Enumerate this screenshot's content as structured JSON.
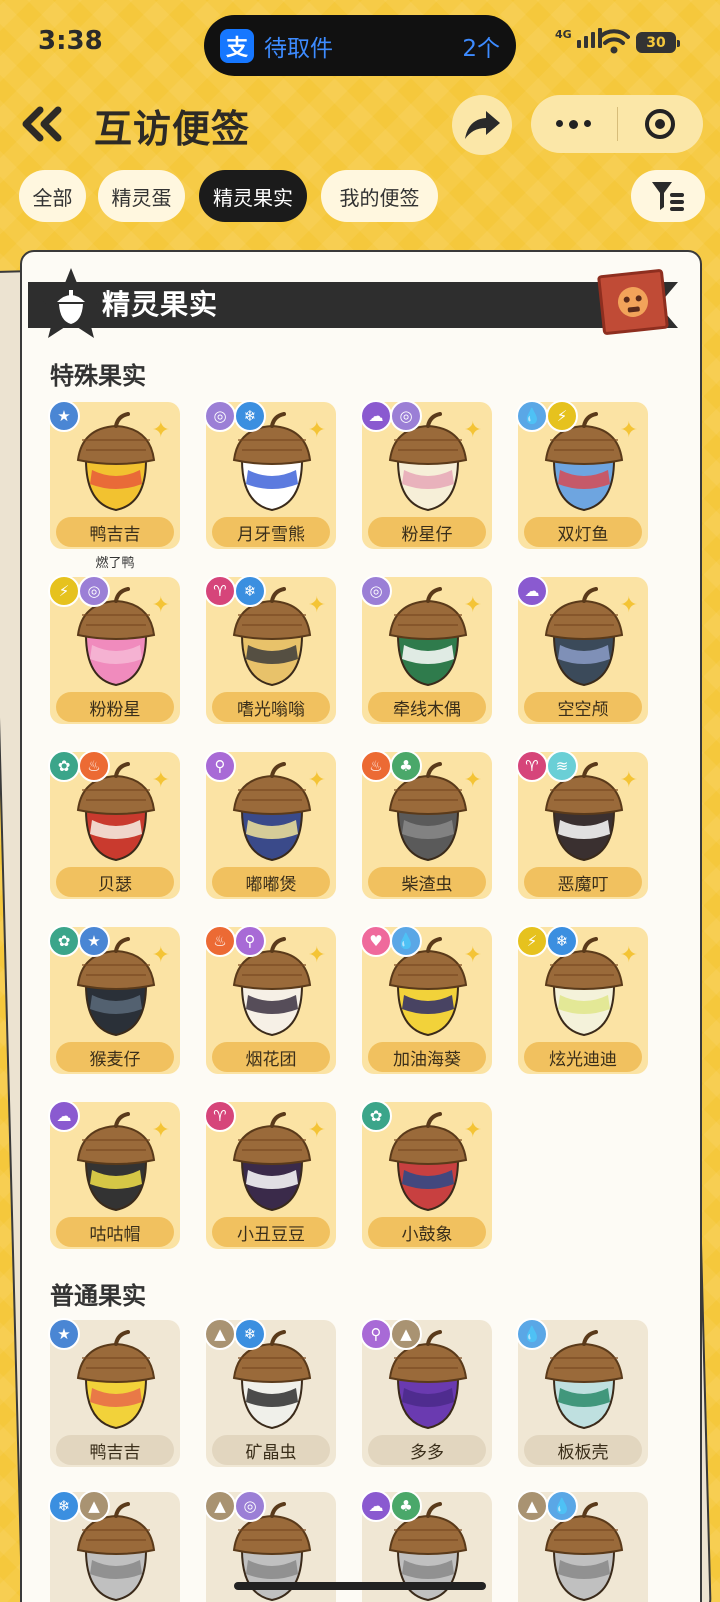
{
  "status_bar": {
    "time": "3:38",
    "island_text": "待取件",
    "island_count": "2个",
    "network": "4G",
    "battery": "30"
  },
  "nav": {
    "title": "互访便签"
  },
  "tabs": [
    {
      "label": "全部",
      "active": false
    },
    {
      "label": "精灵蛋",
      "active": false
    },
    {
      "label": "精灵果实",
      "active": true
    },
    {
      "label": "我的便签",
      "active": false
    }
  ],
  "panel": {
    "title": "精灵果实"
  },
  "sections": [
    {
      "title": "特殊果实",
      "kind": "special"
    },
    {
      "title": "普通果实",
      "kind": "normal"
    }
  ],
  "special_fruits": [
    {
      "name": "鸭吉吉",
      "sub": "燃了鸭",
      "types": [
        "star",
        "none"
      ],
      "colors": [
        "#f2c230",
        "#e85a3a"
      ]
    },
    {
      "name": "月牙雪熊",
      "types": [
        "swirl",
        "ice"
      ],
      "colors": [
        "#ffffff",
        "#3f64d9"
      ]
    },
    {
      "name": "粉星仔",
      "types": [
        "ghost",
        "swirl"
      ],
      "colors": [
        "#f6efd8",
        "#e6a7b7"
      ]
    },
    {
      "name": "双灯鱼",
      "types": [
        "water",
        "electric"
      ],
      "colors": [
        "#6ea5e0",
        "#d64b54"
      ]
    },
    {
      "name": "粉粉星",
      "types": [
        "electric",
        "swirl"
      ],
      "colors": [
        "#f08bbd",
        "#f6b9d6"
      ]
    },
    {
      "name": "嗜光嗡嗡",
      "types": [
        "demon",
        "ice"
      ],
      "colors": [
        "#e8c26a",
        "#3b3b3b"
      ]
    },
    {
      "name": "牵线木偶",
      "types": [
        "swirl"
      ],
      "colors": [
        "#2f7b4c",
        "#ffffff"
      ]
    },
    {
      "name": "空空颅",
      "types": [
        "ghost"
      ],
      "colors": [
        "#3b4a5a",
        "#8c9cc8"
      ]
    },
    {
      "name": "贝瑟",
      "types": [
        "flower",
        "fire"
      ],
      "colors": [
        "#c93a2e",
        "#f7f2e6"
      ]
    },
    {
      "name": "嘟嘟煲",
      "types": [
        "search"
      ],
      "colors": [
        "#3a4a8a",
        "#f1e39a"
      ]
    },
    {
      "name": "柴渣虫",
      "types": [
        "fire",
        "leaf"
      ],
      "colors": [
        "#5a5a5a",
        "#8a8a8a"
      ]
    },
    {
      "name": "恶魔叮",
      "types": [
        "demon",
        "wing"
      ],
      "colors": [
        "#3a3030",
        "#ffffff"
      ]
    },
    {
      "name": "猴麦仔",
      "types": [
        "flower",
        "star"
      ],
      "colors": [
        "#2a3038",
        "#5a6a7a"
      ]
    },
    {
      "name": "烟花团",
      "types": [
        "fire",
        "search"
      ],
      "colors": [
        "#f6f0e6",
        "#3a3040"
      ]
    },
    {
      "name": "加油海葵",
      "types": [
        "heart",
        "water"
      ],
      "colors": [
        "#f2d23a",
        "#2a2a6a"
      ]
    },
    {
      "name": "炫光迪迪",
      "types": [
        "electric",
        "ice"
      ],
      "colors": [
        "#f4f2da",
        "#dfe68a"
      ]
    },
    {
      "name": "咕咕帽",
      "types": [
        "ghost"
      ],
      "colors": [
        "#333333",
        "#f2e24a"
      ]
    },
    {
      "name": "小丑豆豆",
      "types": [
        "demon"
      ],
      "colors": [
        "#3a2a4a",
        "#ffffff"
      ]
    },
    {
      "name": "小鼓象",
      "types": [
        "flower"
      ],
      "colors": [
        "#c84040",
        "#2a4a8a"
      ]
    }
  ],
  "normal_fruits": [
    {
      "name": "鸭吉吉",
      "types": [
        "star"
      ],
      "colors": [
        "#f2d23a",
        "#e86a4a"
      ]
    },
    {
      "name": "矿晶虫",
      "types": [
        "mountain",
        "ice"
      ],
      "colors": [
        "#f0f0ea",
        "#2e2e2e"
      ]
    },
    {
      "name": "多多",
      "types": [
        "search",
        "mountain"
      ],
      "colors": [
        "#6a3ab0",
        "#4a2a8a"
      ]
    },
    {
      "name": "板板壳",
      "types": [
        "water"
      ],
      "colors": [
        "#bfe0e0",
        "#2a8a6a"
      ]
    },
    {
      "name": "",
      "types": [
        "ice",
        "mountain"
      ],
      "colors": [
        "#c0c0c0",
        "#888888"
      ]
    },
    {
      "name": "",
      "types": [
        "mountain",
        "swirl"
      ],
      "colors": [
        "#c0c0c0",
        "#888888"
      ]
    },
    {
      "name": "",
      "types": [
        "ghost",
        "leaf"
      ],
      "colors": [
        "#c0c0c0",
        "#888888"
      ]
    },
    {
      "name": "",
      "types": [
        "mountain",
        "water"
      ],
      "colors": [
        "#c0c0c0",
        "#888888"
      ]
    }
  ],
  "type_colors": {
    "star": "#4a86d4",
    "swirl": "#9b7fd6",
    "ice": "#3b8fe0",
    "ghost": "#8a5ad0",
    "water": "#5aa7e6",
    "electric": "#e6c21e",
    "demon": "#d6457a",
    "flower": "#3ba58a",
    "fire": "#ec6a34",
    "search": "#a86ad6",
    "leaf": "#4aa86a",
    "wing": "#6acfd6",
    "heart": "#ef6a9c",
    "mountain": "#a99372",
    "none": "#cccccc"
  }
}
